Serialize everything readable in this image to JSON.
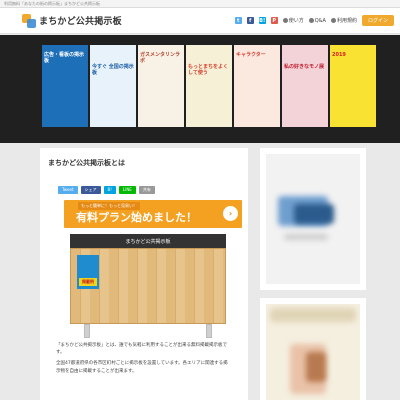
{
  "topbar": {
    "text": "利用無料「あなたの街の掲示板」まちかど公共掲示板"
  },
  "header": {
    "site_title": "まちかど公共掲示板",
    "nav": {
      "howto": "使い方",
      "qa": "Q&A",
      "terms": "利用規約",
      "login": "ログイン"
    },
    "social": [
      "t",
      "f",
      "B!",
      "P"
    ]
  },
  "hero": {
    "posters": [
      {
        "text": "広告・看板の掲示板",
        "bg": "#1d6fb8",
        "fg": "#ffffff"
      },
      {
        "text": "今すぐ 全国の掲示板",
        "bg": "#e8f2fb",
        "fg": "#1b5fa6"
      },
      {
        "text": "ガスメンタリンラボ",
        "bg": "#f7f1e6",
        "fg": "#b2402a"
      },
      {
        "text": "もっとまちをよくして使う",
        "bg": "#f6f1d6",
        "fg": "#d23d2b"
      },
      {
        "text": "キャラクター",
        "bg": "#fbe9e0",
        "fg": "#d33b2c"
      },
      {
        "text": "私の好きなモノ展",
        "bg": "#f4d3d8",
        "fg": "#c11b2f"
      },
      {
        "text": "2019",
        "bg": "#f9e231",
        "fg": "#d81f26"
      }
    ]
  },
  "main": {
    "title": "まちかど公共掲示板とは",
    "share": [
      "Tweet",
      "シェア",
      "B!",
      "LINE",
      "共有"
    ],
    "banner": {
      "small": "もっと簡単に！もっと見易い！",
      "main": "有料プラン始めました！",
      "arrow": "›"
    },
    "board": {
      "title": "まちかど公共掲示板",
      "poster_label": "掲載例"
    },
    "paragraphs": [
      "「まちかど公共掲示板」とは、誰でも気軽に利用することが出来る無料掲載掲示板です。",
      "全国47都道府県の各市区町村ごとに掲示板を設置しています。各エリアに関連する掲示物を自由に掲載することが出来ます。"
    ]
  },
  "colors": {
    "accent": "#f0a92d",
    "twitter": "#55acee",
    "facebook": "#3b5998",
    "hatena": "#00a4de",
    "line": "#00b900"
  }
}
